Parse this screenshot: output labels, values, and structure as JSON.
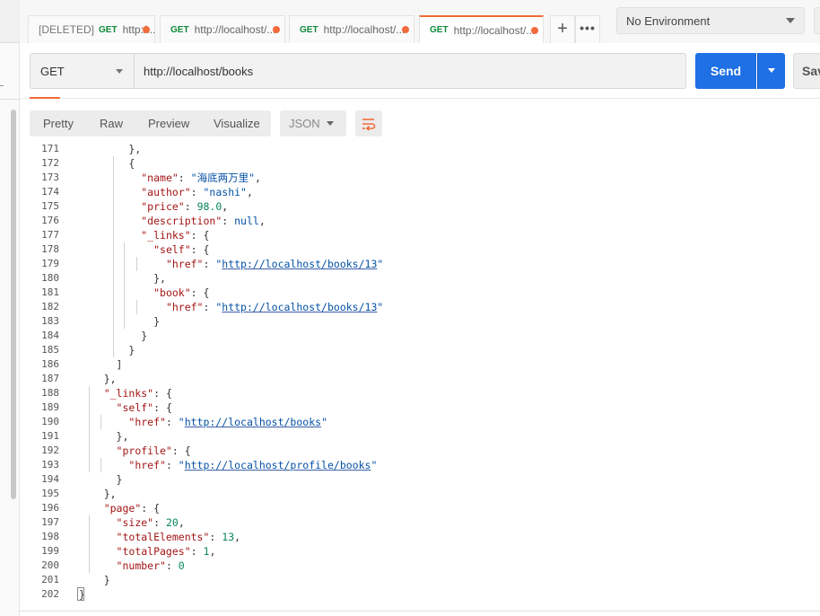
{
  "tabs": [
    {
      "deleted_label": "[DELETED]",
      "method": "GET",
      "url": "http:/..."
    },
    {
      "deleted_label": "",
      "method": "GET",
      "url": "http://localhost/..."
    },
    {
      "deleted_label": "",
      "method": "GET",
      "url": "http://localhost/..."
    },
    {
      "deleted_label": "",
      "method": "GET",
      "url": "http://localhost/..."
    }
  ],
  "tab_actions": {
    "add": "+",
    "more": "•••"
  },
  "environment": {
    "selected": "No Environment"
  },
  "request": {
    "method": "GET",
    "url": "http://localhost/books"
  },
  "buttons": {
    "send": "Send",
    "save": "Sav"
  },
  "response_toolbar": {
    "views": [
      "Pretty",
      "Raw",
      "Preview",
      "Visualize"
    ],
    "language": "JSON"
  },
  "colors": {
    "accent": "#f26b3a",
    "send": "#1f6fe5",
    "method_green": "#0f8a3a"
  },
  "code_lines": [
    {
      "n": "171",
      "t": "        },"
    },
    {
      "n": "172",
      "t": "        {"
    },
    {
      "n": "173",
      "t": "          \"name\": \"海底两万里\","
    },
    {
      "n": "174",
      "t": "          \"author\": \"nashi\","
    },
    {
      "n": "175",
      "t": "          \"price\": 98.0,"
    },
    {
      "n": "176",
      "t": "          \"description\": null,"
    },
    {
      "n": "177",
      "t": "          \"_links\": {"
    },
    {
      "n": "178",
      "t": "            \"self\": {"
    },
    {
      "n": "179",
      "t": "              \"href\": \"http://localhost/books/13\""
    },
    {
      "n": "180",
      "t": "            },"
    },
    {
      "n": "181",
      "t": "            \"book\": {"
    },
    {
      "n": "182",
      "t": "              \"href\": \"http://localhost/books/13\""
    },
    {
      "n": "183",
      "t": "            }"
    },
    {
      "n": "184",
      "t": "          }"
    },
    {
      "n": "185",
      "t": "        }"
    },
    {
      "n": "186",
      "t": "      ]"
    },
    {
      "n": "187",
      "t": "    },"
    },
    {
      "n": "188",
      "t": "    \"_links\": {"
    },
    {
      "n": "189",
      "t": "      \"self\": {"
    },
    {
      "n": "190",
      "t": "        \"href\": \"http://localhost/books\""
    },
    {
      "n": "191",
      "t": "      },"
    },
    {
      "n": "192",
      "t": "      \"profile\": {"
    },
    {
      "n": "193",
      "t": "        \"href\": \"http://localhost/profile/books\""
    },
    {
      "n": "194",
      "t": "      }"
    },
    {
      "n": "195",
      "t": "    },"
    },
    {
      "n": "196",
      "t": "    \"page\": {"
    },
    {
      "n": "197",
      "t": "      \"size\": 20,"
    },
    {
      "n": "198",
      "t": "      \"totalElements\": 13,"
    },
    {
      "n": "199",
      "t": "      \"totalPages\": 1,"
    },
    {
      "n": "200",
      "t": "      \"number\": 0"
    },
    {
      "n": "201",
      "t": "    }"
    },
    {
      "n": "202",
      "t": "}"
    }
  ]
}
